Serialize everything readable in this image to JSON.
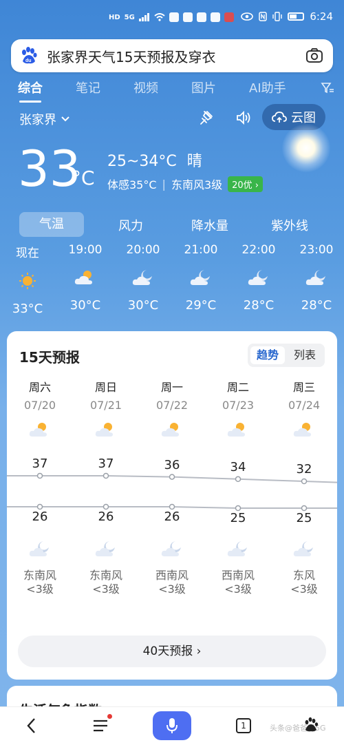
{
  "status": {
    "time": "6:24",
    "hd": "HD",
    "signal": "5G"
  },
  "search": {
    "query": "张家界天气15天预报及穿衣"
  },
  "tabs": [
    {
      "label": "综合"
    },
    {
      "label": "笔记"
    },
    {
      "label": "视频"
    },
    {
      "label": "图片"
    },
    {
      "label": "AI助手"
    }
  ],
  "location": {
    "city": "张家界",
    "cloud_btn": "云图"
  },
  "current": {
    "temp": "33",
    "unit": "°C",
    "range": "25~34°C",
    "condition": "晴",
    "feel": "体感35°C",
    "separator": "|",
    "wind": "东南风3级",
    "aqi": "20优"
  },
  "metrics": [
    {
      "label": "气温"
    },
    {
      "label": "风力"
    },
    {
      "label": "降水量"
    },
    {
      "label": "紫外线"
    }
  ],
  "hourly": [
    {
      "time": "现在",
      "temp": "33°C",
      "icon": "sun-icon"
    },
    {
      "time": "19:00",
      "temp": "30°C",
      "icon": "sun-cloud-icon"
    },
    {
      "time": "20:00",
      "temp": "30°C",
      "icon": "moon-cloud-icon"
    },
    {
      "time": "21:00",
      "temp": "29°C",
      "icon": "moon-cloud-icon"
    },
    {
      "time": "22:00",
      "temp": "28°C",
      "icon": "moon-cloud-icon"
    },
    {
      "time": "23:00",
      "temp": "28°C",
      "icon": "moon-cloud-icon"
    }
  ],
  "forecast": {
    "title": "15天预报",
    "toggle_trend": "趋势",
    "toggle_list": "列表",
    "days": [
      {
        "name": "周六",
        "date": "07/20",
        "high": 37,
        "low": 26,
        "wind": "东南风",
        "level": "<3级"
      },
      {
        "name": "周日",
        "date": "07/21",
        "high": 37,
        "low": 26,
        "wind": "东南风",
        "level": "<3级"
      },
      {
        "name": "周一",
        "date": "07/22",
        "high": 36,
        "low": 26,
        "wind": "西南风",
        "level": "<3级"
      },
      {
        "name": "周二",
        "date": "07/23",
        "high": 34,
        "low": 25,
        "wind": "西南风",
        "level": "<3级"
      },
      {
        "name": "周三",
        "date": "07/24",
        "high": 32,
        "low": 25,
        "wind": "东风",
        "level": "<3级"
      }
    ],
    "more_button": "40天预报 ›"
  },
  "next_card": {
    "title": "生活气象指数"
  },
  "nav": {
    "tab_count": "1",
    "watermark": "头条@爸爸说5G"
  },
  "colors": {
    "accent": "#2867ce",
    "aqi_green": "#39b54a",
    "mic_blue": "#4e6ef2"
  }
}
